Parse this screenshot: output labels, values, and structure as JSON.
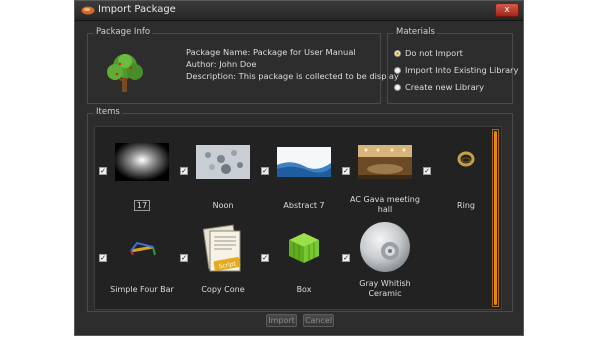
{
  "window": {
    "title": "Import Package",
    "close_label": "x"
  },
  "package_info": {
    "group_title": "Package Info",
    "name_line": "Package Name: Package for User Manual",
    "author_line": "Author: John Doe",
    "description_line": "Description: This package is collected to be display"
  },
  "materials": {
    "group_title": "Materials",
    "options": [
      {
        "label": "Do not Import",
        "selected": true
      },
      {
        "label": "Import Into Existing Library",
        "selected": false
      },
      {
        "label": "Create new Library",
        "selected": false
      }
    ]
  },
  "items": {
    "group_title": "Items",
    "list": [
      {
        "label": "17",
        "checked": true,
        "icon": "dark-spotlight-thumbnail"
      },
      {
        "label": "Noon",
        "checked": true,
        "icon": "snowy-landscape-thumbnail"
      },
      {
        "label": "Abstract 7",
        "checked": true,
        "icon": "abstract-blue-wave-thumbnail"
      },
      {
        "label": "AC Gava meeting hall",
        "checked": true,
        "icon": "meeting-hall-thumbnail"
      },
      {
        "label": "Ring",
        "checked": true,
        "icon": "ring-thumbnail"
      },
      {
        "label": "Simple Four Bar",
        "checked": true,
        "icon": "four-bar-linkage-thumbnail"
      },
      {
        "label": "Copy Cone",
        "checked": true,
        "icon": "script-document-thumbnail"
      },
      {
        "label": "Box",
        "checked": true,
        "icon": "green-box-thumbnail"
      },
      {
        "label": "Gray Whitish Ceramic",
        "checked": true,
        "icon": "ceramic-sphere-thumbnail"
      }
    ]
  },
  "buttons": {
    "import": "Import",
    "cancel": "Cancel"
  },
  "colors": {
    "window_bg": "#2d2d2d",
    "accent_orange": "#e0890f",
    "text": "#dcdcdc"
  }
}
